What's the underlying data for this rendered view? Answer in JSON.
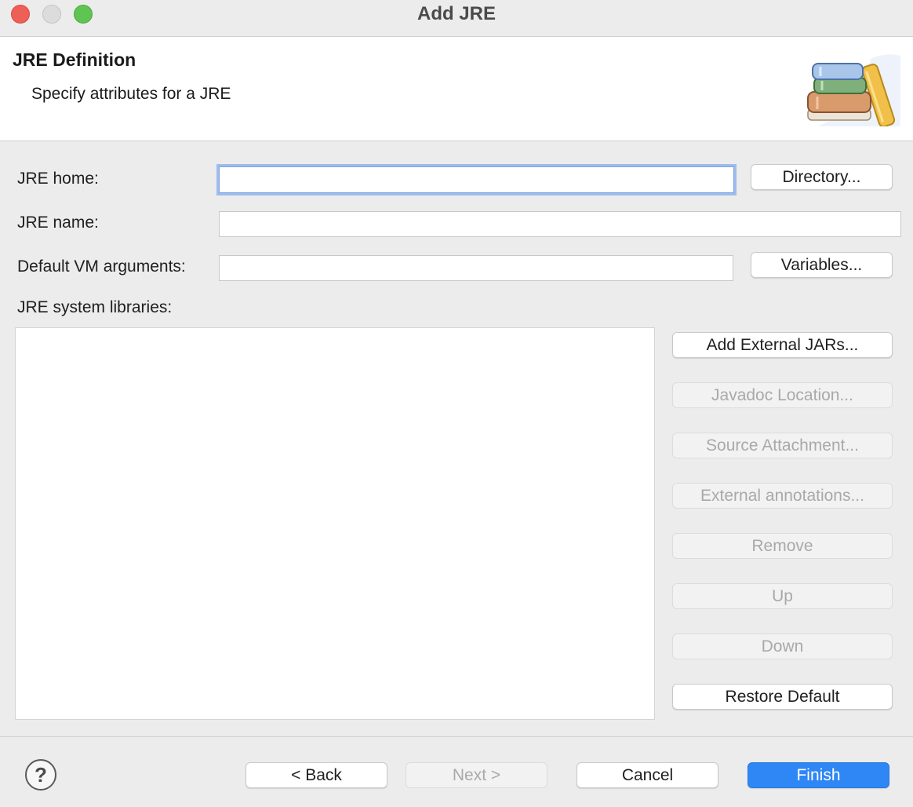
{
  "window": {
    "title": "Add JRE"
  },
  "banner": {
    "title": "JRE Definition",
    "description": "Specify attributes for a JRE",
    "icon": "jre-library-books-icon"
  },
  "form": {
    "jre_home": {
      "label": "JRE home:",
      "value": "",
      "placeholder": ""
    },
    "jre_name": {
      "label": "JRE name:",
      "value": "",
      "placeholder": ""
    },
    "vm_args": {
      "label": "Default VM arguments:",
      "value": "",
      "placeholder": ""
    },
    "directory_button": "Directory...",
    "variables_button": "Variables...",
    "libraries_label": "JRE system libraries:"
  },
  "library_buttons": {
    "add_external_jars": "Add External JARs...",
    "javadoc_location": "Javadoc Location...",
    "source_attachment": "Source Attachment...",
    "external_annotations": "External annotations...",
    "remove": "Remove",
    "up": "Up",
    "down": "Down",
    "restore_default": "Restore Default"
  },
  "footer": {
    "help": "?",
    "back": "< Back",
    "next": "Next >",
    "cancel": "Cancel",
    "finish": "Finish"
  },
  "colors": {
    "primary": "#2f86f5",
    "focus_ring": "#9dbcee",
    "disabled_text": "#a9a9a9"
  }
}
